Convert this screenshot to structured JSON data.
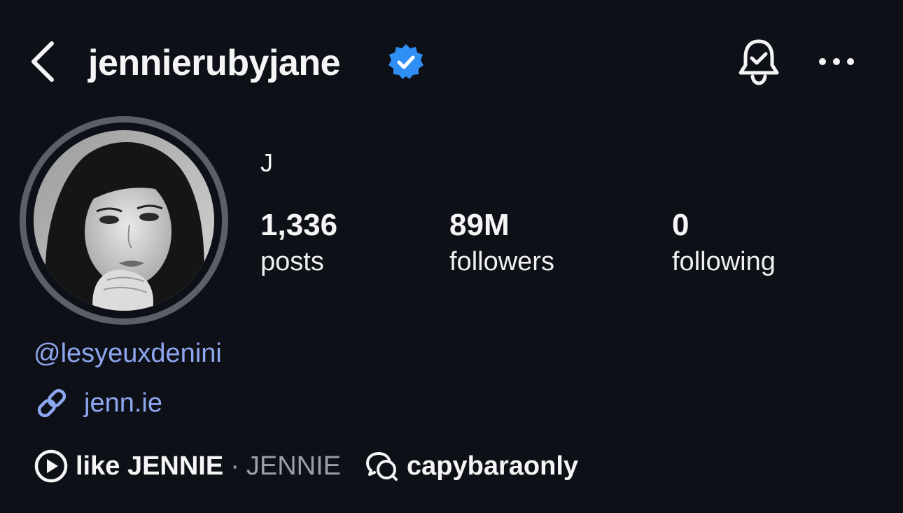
{
  "header": {
    "username": "jennierubyjane",
    "verified": true,
    "back_icon": "chevron-left-icon",
    "bell_icon": "bell-check-icon",
    "more_icon": "more-horizontal-icon"
  },
  "profile": {
    "display_name": "J",
    "stats": [
      {
        "value": "1,336",
        "label": "posts"
      },
      {
        "value": "89M",
        "label": "followers"
      },
      {
        "value": "0",
        "label": "following"
      }
    ],
    "mention": "@lesyeuxdenini",
    "link": "jenn.ie",
    "music": {
      "song": "like JENNIE",
      "separator": "·",
      "artist": "JENNIE"
    },
    "threads_handle": "capybaraonly"
  },
  "colors": {
    "background": "#0d1117",
    "text": "#f5f5f5",
    "link": "#8fa6f0",
    "muted": "#9aa0a8",
    "verified_badge": "#2f8ff5"
  }
}
